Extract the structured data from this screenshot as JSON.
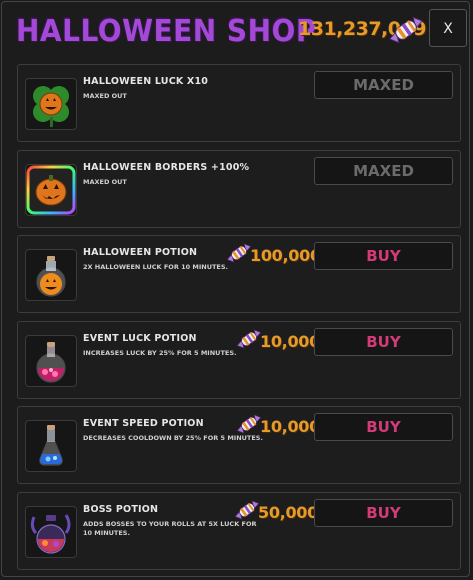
{
  "shop": {
    "title": "HALLOWEEN SHOP",
    "currency_amount": "131,237,049",
    "currency_icon": "candy-icon",
    "close_label": "X"
  },
  "items": [
    {
      "name": "HALLOWEEN LUCK X10",
      "description": "MAXED OUT",
      "price": "",
      "button": "MAXED",
      "icon": "pumpkin-clover-icon"
    },
    {
      "name": "HALLOWEEN BORDERS +100%",
      "description": "MAXED OUT",
      "price": "",
      "button": "MAXED",
      "icon": "pumpkin-border-icon"
    },
    {
      "name": "HALLOWEEN POTION",
      "description": "2X HALLOWEEN LUCK FOR 10 MINUTES.",
      "price": "100,000",
      "button": "BUY",
      "icon": "pumpkin-potion-icon"
    },
    {
      "name": "EVENT LUCK POTION",
      "description": "INCREASES LUCK BY 25% FOR 5 MINUTES.",
      "price": "10,000",
      "button": "BUY",
      "icon": "pink-potion-icon"
    },
    {
      "name": "EVENT SPEED POTION",
      "description": "DECREASES COOLDOWN BY 25% FOR 5 MINUTES.",
      "price": "10,000",
      "button": "BUY",
      "icon": "blue-potion-icon"
    },
    {
      "name": "BOSS POTION",
      "description": "ADDS BOSSES TO YOUR ROLLS AT 5X LUCK FOR 10 MINUTES.",
      "price": "50,000",
      "button": "BUY",
      "icon": "boss-potion-icon"
    }
  ],
  "colors": {
    "title": "#a24ad6",
    "currency": "#e59a2a",
    "buy": "#d43a78",
    "maxed": "#6b6b6b"
  }
}
